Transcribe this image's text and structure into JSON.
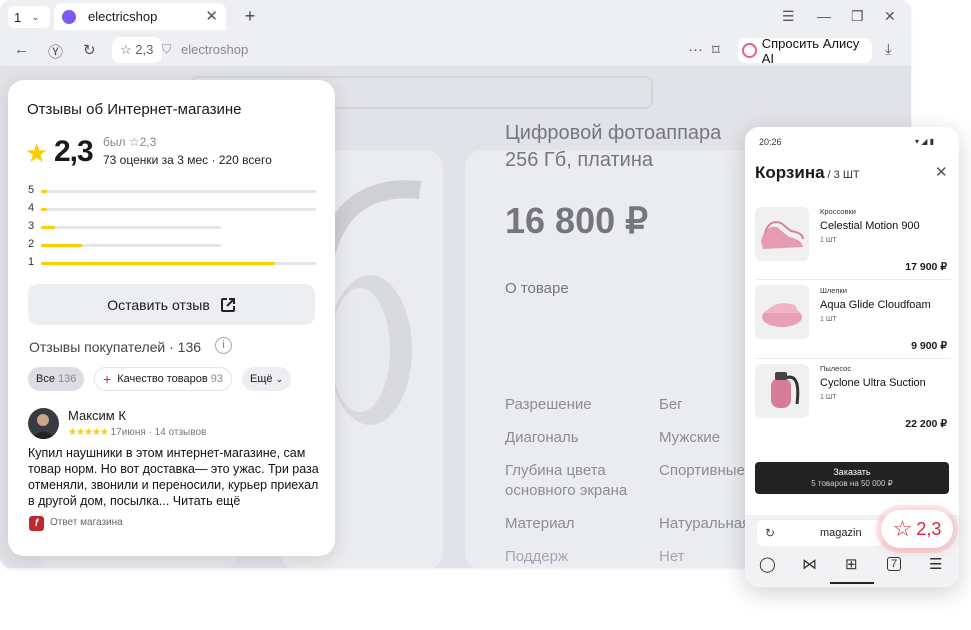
{
  "browser": {
    "tab_count": "1",
    "tab_title": "electricshop",
    "address_rating": "2,3",
    "address_domain": "electroshop",
    "ask_alice": "Спросить Алису AI"
  },
  "page": {
    "product_title_1": "Цифровой фотоаппара",
    "product_title_2": "256 Гб, платина",
    "price": "16 800 ₽",
    "about": "О товаре",
    "specs": [
      {
        "k": "Разрешение",
        "v": "Бег"
      },
      {
        "k": "Диагональ",
        "v": "Мужские"
      },
      {
        "k": "Глубина цвета основного экрана",
        "v": "Спортивные"
      },
      {
        "k": "Материал",
        "v": "Натуральная"
      },
      {
        "k": "Поддерж",
        "v": "Нет"
      }
    ]
  },
  "reviews": {
    "title": "Отзывы об Интернет-магазине",
    "rating": "2,3",
    "was": "был ☆2,3",
    "counts": "73 оценки за 3 мес · 220 всего",
    "bars": [
      {
        "label": "5",
        "fill": 0.02
      },
      {
        "label": "4",
        "fill": 0.02
      },
      {
        "label": "3",
        "fill": 0.05
      },
      {
        "label": "2",
        "fill": 0.15
      },
      {
        "label": "1",
        "fill": 0.85
      }
    ],
    "leave_review": "Оставить отзыв",
    "buyers_reviews": "Отзывы покупателей  ·  136",
    "chip_all": "Все",
    "chip_all_count": "136",
    "chip_quality": "Качество товаров",
    "chip_quality_count": "93",
    "chip_more": "Ещё",
    "review": {
      "author": "Максим К",
      "stars": "★★★★★",
      "meta": "17июня · 14 отзывов",
      "text_plain": "Купил наушники в этом интернет-магазине, сам товар норм. ",
      "text_bold": "Но вот доставка— это ужас. Три раза отменяли, звонили и переносили, курьер приехал в другой дом,",
      "text_tail": " посылка... Читать ещё",
      "shop_reply": "Ответ магазина"
    }
  },
  "phone": {
    "time": "20:26",
    "cart_title": "Корзина",
    "cart_count": "/ 3 ШТ",
    "items": [
      {
        "cat": "Кроссовки",
        "name": "Celestial Motion 900",
        "qty": "1 ШТ",
        "price": "17 900 ₽"
      },
      {
        "cat": "Шлепки",
        "name": "Aqua Glide Cloudfoam",
        "qty": "1 ШТ",
        "price": "9 900 ₽"
      },
      {
        "cat": "Пылесос",
        "name": "Cyclone Ultra Suction",
        "qty": "1 ШТ",
        "price": "22 200 ₽"
      }
    ],
    "order": "Заказать",
    "order_sub": "5 товаров на 50 000 ₽",
    "url": "magazin",
    "tabs_count": "7"
  },
  "badge": {
    "rating": "2,3"
  },
  "colors": {
    "accent_star": "#ffcc00",
    "badge_red": "#e0243a",
    "alice_pink": "#f05a8c"
  }
}
